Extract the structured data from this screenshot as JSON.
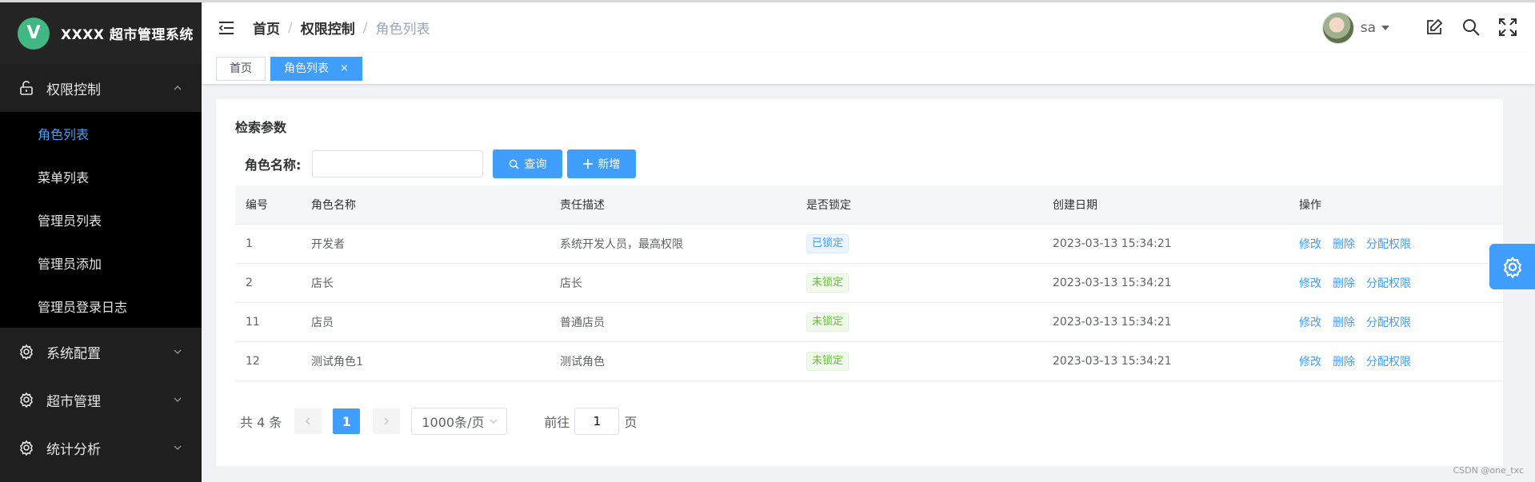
{
  "app": {
    "logo_letter": "V",
    "title": "XXXX 超市管理系统"
  },
  "sidebar": {
    "groups": [
      {
        "label": "权限控制",
        "icon": "unlock-icon",
        "expanded": true,
        "items": [
          {
            "label": "角色列表",
            "active": true
          },
          {
            "label": "菜单列表"
          },
          {
            "label": "管理员列表"
          },
          {
            "label": "管理员添加"
          },
          {
            "label": "管理员登录日志"
          }
        ]
      },
      {
        "label": "系统配置",
        "icon": "gear-icon"
      },
      {
        "label": "超市管理",
        "icon": "gear-icon"
      },
      {
        "label": "统计分析",
        "icon": "gear-icon"
      }
    ]
  },
  "header": {
    "breadcrumb": [
      "首页",
      "权限控制",
      "角色列表"
    ],
    "user": "sa"
  },
  "tags": [
    {
      "label": "首页",
      "active": false
    },
    {
      "label": "角色列表",
      "active": true,
      "close": "×"
    }
  ],
  "search": {
    "title": "检索参数",
    "label": "角色名称:",
    "value": "",
    "query_button": "查询",
    "add_button": "新增"
  },
  "table": {
    "columns": [
      "编号",
      "角色名称",
      "责任描述",
      "是否锁定",
      "创建日期",
      "操作"
    ],
    "rows": [
      {
        "id": "1",
        "name": "开发者",
        "desc": "系统开发人员，最高权限",
        "lock": "已锁定",
        "created": "2023-03-13 15:34:21"
      },
      {
        "id": "2",
        "name": "店长",
        "desc": "店长",
        "lock": "未锁定",
        "created": "2023-03-13 15:34:21"
      },
      {
        "id": "11",
        "name": "店员",
        "desc": "普通店员",
        "lock": "未锁定",
        "created": "2023-03-13 15:34:21"
      },
      {
        "id": "12",
        "name": "测试角色1",
        "desc": "测试角色",
        "lock": "未锁定",
        "created": "2023-03-13 15:34:21"
      }
    ],
    "actions": [
      "修改",
      "删除",
      "分配权限"
    ]
  },
  "pagination": {
    "total": "共 4 条",
    "current_page": "1",
    "page_size": "1000条/页",
    "goto_prefix": "前往",
    "goto_value": "1",
    "goto_suffix": "页"
  },
  "watermark": "CSDN @one_txc",
  "colors": {
    "accent": "#409eff",
    "sidebar_bg": "#1f1f1f",
    "submenu_bg": "#000000",
    "success": "#67c23a"
  }
}
